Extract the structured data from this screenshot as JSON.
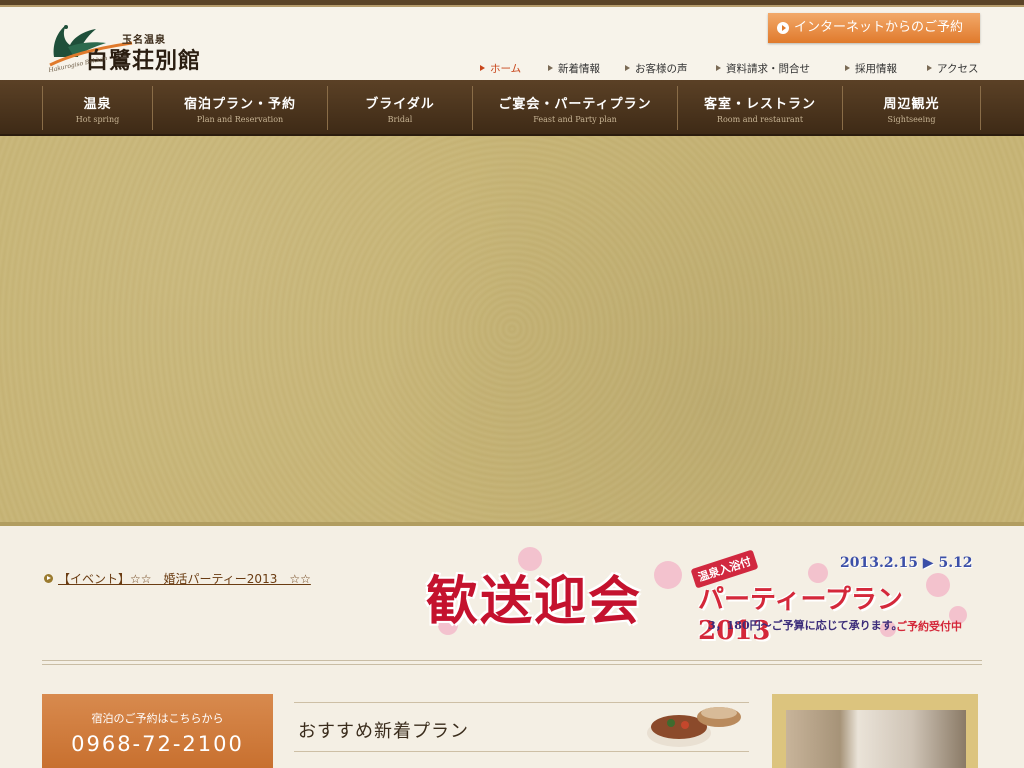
{
  "header": {
    "logo_sub": "玉名温泉",
    "logo_main": "白鷺荘別館",
    "logo_roman": "Hakurogiso Bekkan",
    "reserve_button": "インターネットからのご予約"
  },
  "top_nav": [
    {
      "label": "ホーム",
      "active": true
    },
    {
      "label": "新着情報",
      "active": false
    },
    {
      "label": "お客様の声",
      "active": false
    },
    {
      "label": "資料請求・問合せ",
      "active": false
    },
    {
      "label": "採用情報",
      "active": false
    },
    {
      "label": "アクセス",
      "active": false
    }
  ],
  "main_nav": [
    {
      "jp": "温泉",
      "en": "Hot spring"
    },
    {
      "jp": "宿泊プラン・予約",
      "en": "Plan and Reservation"
    },
    {
      "jp": "ブライダル",
      "en": "Bridal"
    },
    {
      "jp": "ご宴会・パーティプラン",
      "en": "Feast and Party plan"
    },
    {
      "jp": "客室・レストラン",
      "en": "Room and restaurant"
    },
    {
      "jp": "周辺観光",
      "en": "Sightseeing"
    }
  ],
  "news": {
    "link_text": "【イベント】☆☆　婚活パーティー2013　☆☆"
  },
  "banner": {
    "main": "歓送迎会",
    "badge": "温泉入浴付",
    "plan": "パーティープラン 2013",
    "dates": "2013.2.15 ▶ 5.12",
    "price": "3，180円～ご予算に応じて承ります。",
    "accept": "ご予約受付中"
  },
  "booking": {
    "label": "宿泊のご予約はこちらから",
    "phone": "0968-72-2100"
  },
  "plans": {
    "heading": "おすすめ新着プラン"
  },
  "colors": {
    "accent_orange": "#e07a2c",
    "nav_brown": "#4a321b",
    "hero_gold": "#c7b476"
  }
}
